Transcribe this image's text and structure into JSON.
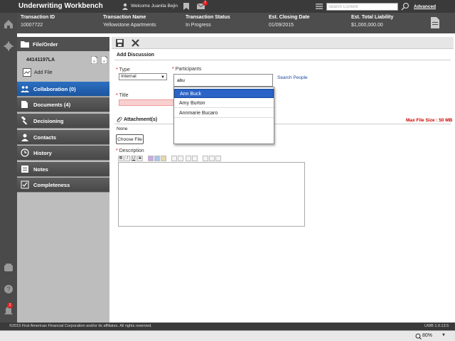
{
  "app": {
    "title": "Underwriting Workbench",
    "welcome": "Welcome Juanita Bejin",
    "mail_count": "7",
    "search_placeholder": "Search Content",
    "advanced_label": "Advanced"
  },
  "transaction": {
    "columns": [
      {
        "label": "Transaction ID",
        "value": "10007722"
      },
      {
        "label": "Transaction Name",
        "value": "Yellowstone Apartments"
      },
      {
        "label": "Transaction Status",
        "value": "In Progress"
      },
      {
        "label": "Est. Closing Date",
        "value": "01/09/2015"
      },
      {
        "label": "Est. Total Liability",
        "value": "$1,000,000.00"
      }
    ]
  },
  "leftrail": {
    "notification_count": "2"
  },
  "nav": {
    "file_order_label": "File/Order",
    "file_id": "44141197LA",
    "add_file_label": "Add File",
    "items": [
      {
        "label": "Collaboration (0)",
        "icon": "collaboration-icon"
      },
      {
        "label": "Documents (4)",
        "icon": "documents-icon"
      },
      {
        "label": "Decisioning",
        "icon": "decisioning-icon"
      },
      {
        "label": "Contacts",
        "icon": "contacts-icon"
      },
      {
        "label": "History",
        "icon": "history-icon"
      },
      {
        "label": "Notes",
        "icon": "notes-icon"
      },
      {
        "label": "Completeness",
        "icon": "completeness-icon"
      }
    ]
  },
  "form": {
    "section_title": "Add Discussion",
    "type_label": "Type",
    "type_value": "Internal",
    "participants_label": "Participants",
    "participants_value": "abu",
    "search_people": "Search People",
    "title_label": "Title",
    "attachments_label": "Attachment(s)",
    "max_file_size": "Max File Size : 50 MB",
    "none_text": "None",
    "choose_file": "Choose File",
    "description_label": "Description",
    "format_buttons": [
      "B",
      "I",
      "U",
      "S",
      "",
      "",
      "",
      "",
      "",
      "",
      "",
      "",
      "",
      ""
    ]
  },
  "dropdown": {
    "options": [
      "Ann Buck",
      "Amy Burton",
      "Annmarie Bucaro"
    ],
    "selected_index": 0
  },
  "footer": {
    "copyright": "©2015 First American Financial Corporation and/or its affiliates. All rights reserved.",
    "version": "UWB 1.0.13.5"
  },
  "statusbar": {
    "zoom": "80%"
  },
  "colors": {
    "accent": "#2b63c7",
    "required": "#dd0000",
    "header": "#4d4d4d"
  }
}
